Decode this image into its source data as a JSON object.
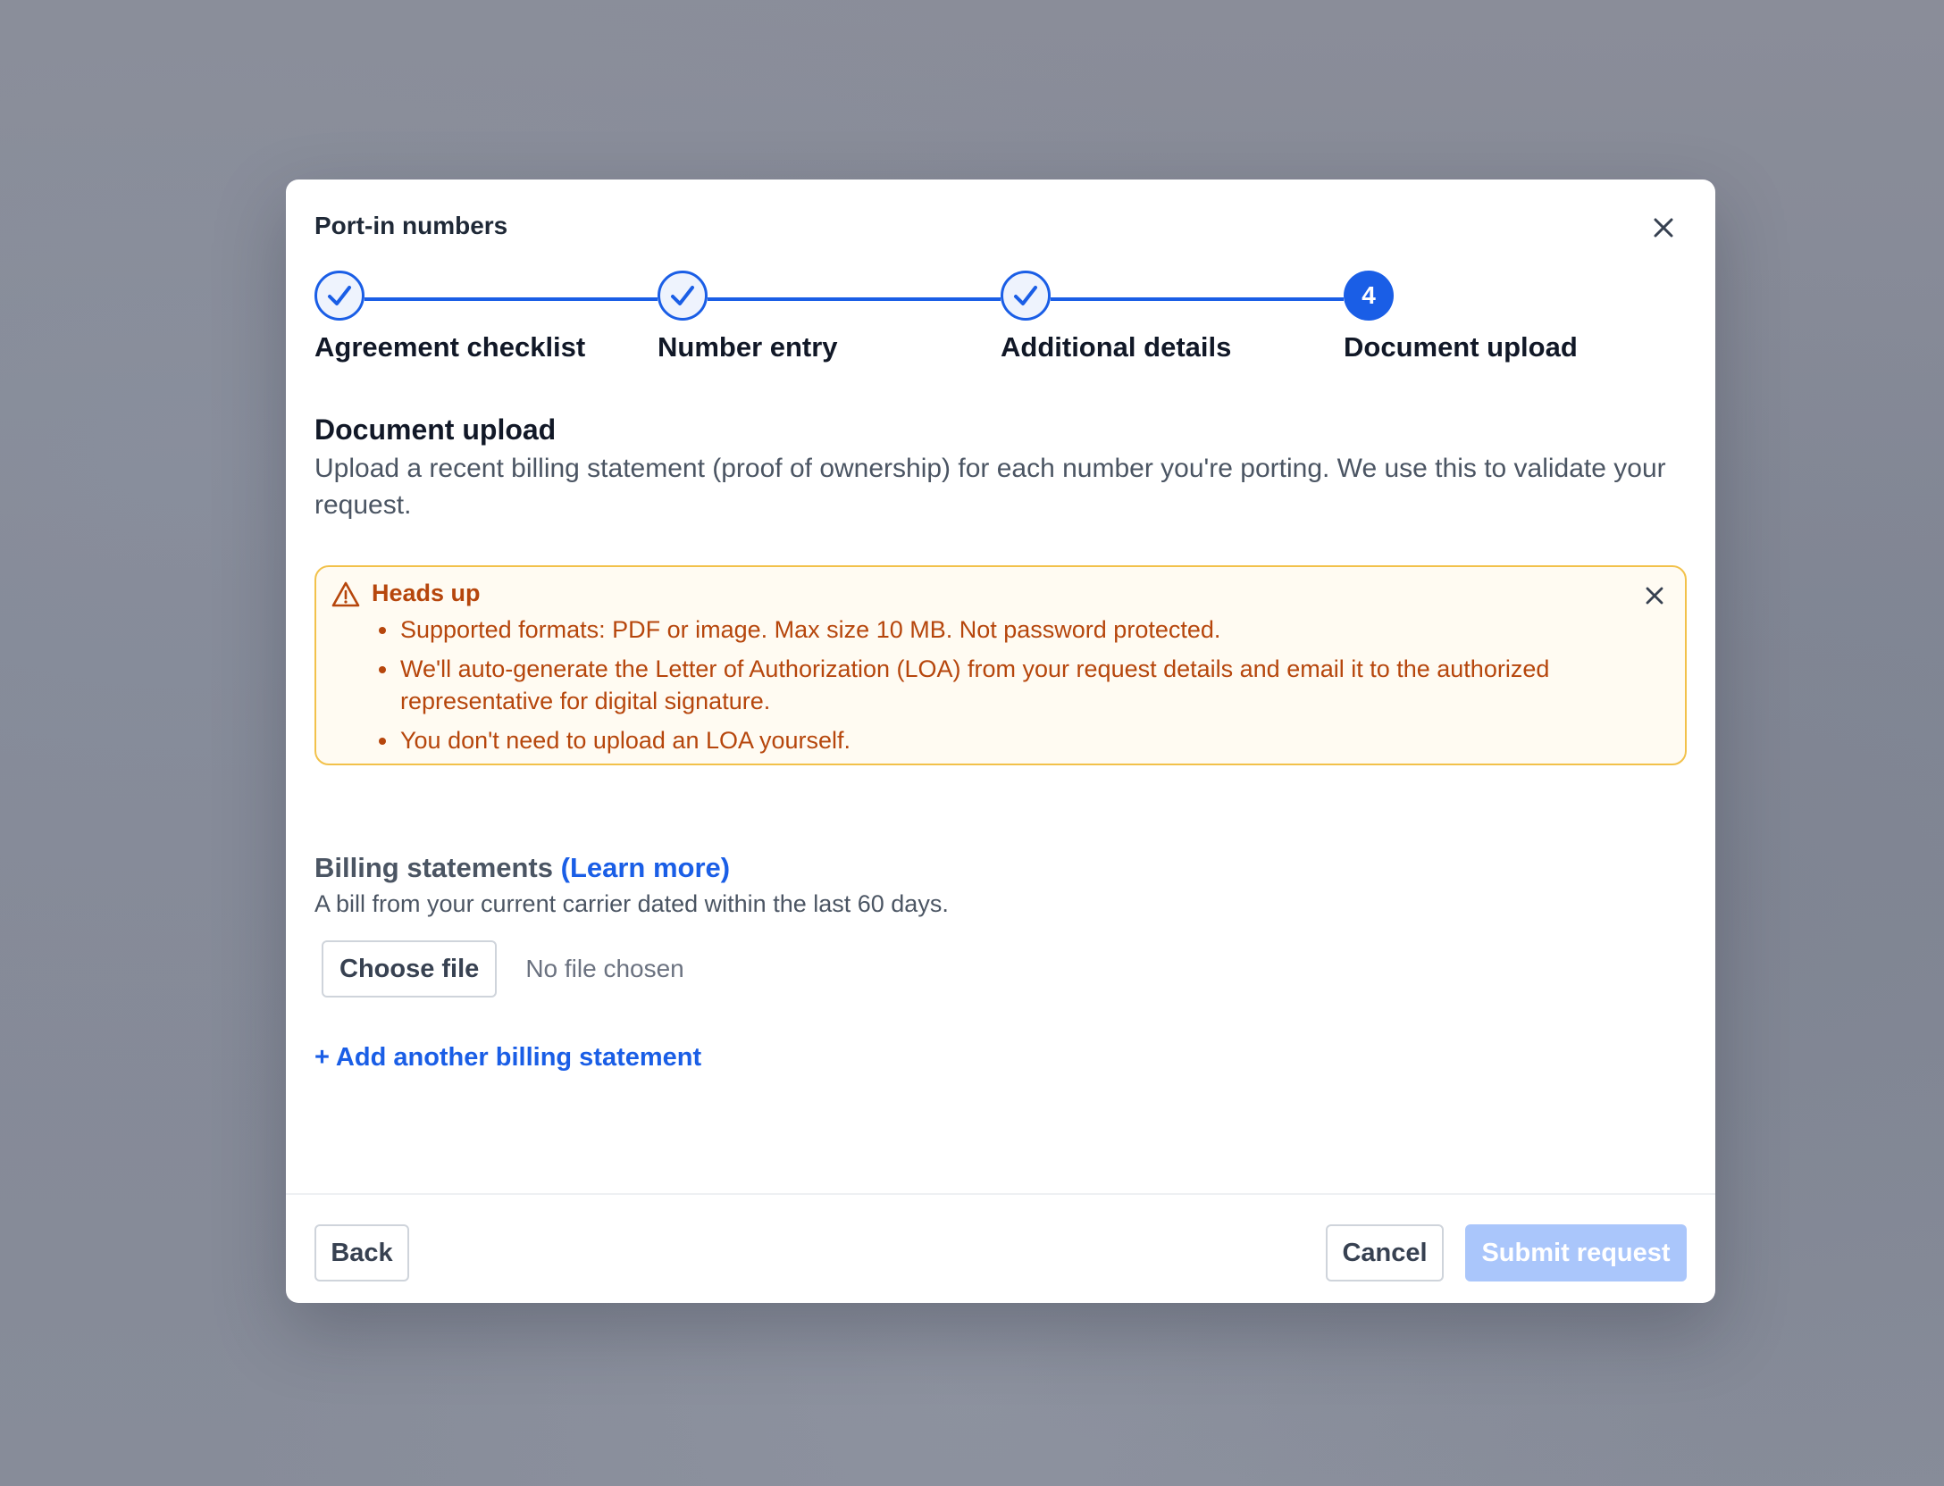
{
  "modal": {
    "title": "Port-in numbers"
  },
  "stepper": {
    "steps": [
      {
        "label": "Agreement checklist",
        "status": "complete"
      },
      {
        "label": "Number entry",
        "status": "complete"
      },
      {
        "label": "Additional details",
        "status": "complete"
      },
      {
        "label": "Document upload",
        "status": "active",
        "number": "4"
      }
    ]
  },
  "section": {
    "title": "Document upload",
    "description": "Upload a recent billing statement (proof of ownership) for each number you're porting. We use this to validate your request."
  },
  "alert": {
    "title": "Heads up",
    "icon": "warning-triangle-icon",
    "items": [
      "Supported formats: PDF or image. Max size 10 MB. Not password protected.",
      "We'll auto-generate the Letter of Authorization (LOA) from your request details and email it to the authorized representative for digital signature.",
      "You don't need to upload an LOA yourself."
    ]
  },
  "billing": {
    "label": "Billing statements",
    "learn_more": "(Learn more)",
    "hint": "A bill from your current carrier dated within the last 60 days.",
    "choose_file": "Choose file",
    "no_file": "No file chosen",
    "add_another": "+ Add another billing statement"
  },
  "footer": {
    "back": "Back",
    "cancel": "Cancel",
    "submit": "Submit request"
  },
  "colors": {
    "accent": "#1a5ee6",
    "alert_border": "#f2c14a",
    "alert_text": "#b6460c",
    "submit_disabled": "#aac6fb"
  }
}
